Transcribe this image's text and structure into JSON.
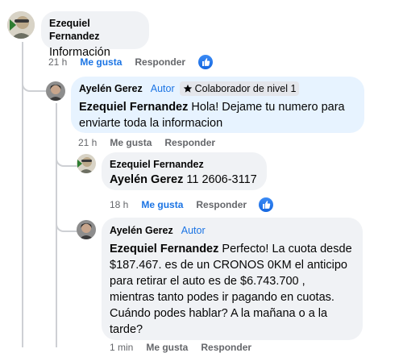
{
  "comments": [
    {
      "author": "Ezequiel Fernandez",
      "text": "Información",
      "time": "21 h",
      "like_label": "Me gusta",
      "reply_label": "Responder"
    },
    {
      "author": "Ayelén Gerez",
      "badge": "Autor",
      "level": "Colaborador de nivel 1",
      "mention": "Ezequiel Fernandez",
      "text": "Hola! Dejame tu numero para enviarte toda la informacion",
      "line1": "Hola! Dejame tu numero para",
      "line2": "enviarte toda la informacion",
      "time": "21 h",
      "like_label": "Me gusta",
      "reply_label": "Responder"
    },
    {
      "author": "Ezequiel Fernandez",
      "mention": "Ayelén Gerez",
      "text": "11 2606-3117",
      "time": "18 h",
      "like_label": "Me gusta",
      "reply_label": "Responder"
    },
    {
      "author": "Ayelén Gerez",
      "badge": "Autor",
      "mention": "Ezequiel Fernandez",
      "line1": "Perfecto! La cuota desde",
      "line2": "$187.467. es de un CRONOS 0KM el anticipo",
      "line3": "para retirar el auto es de $6.743.700 ,",
      "line4": "mientras tanto podes ir pagando en cuotas.",
      "line5": "Cuándo podes hablar? A la mañana o a la",
      "line6": "tarde?",
      "time": "1 min",
      "like_label": "Me gusta",
      "reply_label": "Responder"
    }
  ],
  "colors": {
    "accent": "#1b74e4",
    "bubble_gray": "#f0f2f5",
    "bubble_blue": "#e7f3ff",
    "secondary_text": "#65676b"
  }
}
